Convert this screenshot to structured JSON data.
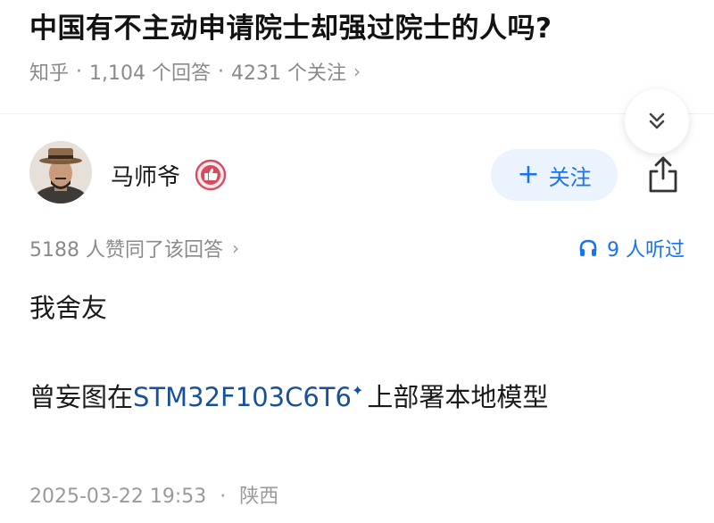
{
  "question": {
    "title": "中国有不主动申请院士却强过院士的人吗?",
    "source": "知乎",
    "answers": "1,104 个回答",
    "followers": "4231 个关注"
  },
  "answer": {
    "author": "马师爷",
    "follow_label": "关注",
    "upvotes": "5188 人赞同了该回答",
    "listeners": "9 人听过",
    "para1": "我舍友",
    "para2_pre": "曾妄图在",
    "para2_link": "STM32F103C6T6",
    "para2_post": "上部署本地模型",
    "date": "2025-03-22 19:53",
    "location": "陕西"
  },
  "icons": {
    "collapse": "double-chevron-down-icon",
    "share": "share-icon",
    "headphones": "headphones-icon",
    "badge": "thumbs-up-badge-icon",
    "link_marker": "sparkle-icon"
  },
  "colors": {
    "accent": "#1772f6",
    "link": "#175199",
    "follow_bg": "#ebf3ff",
    "badge": "#d64b5f"
  }
}
